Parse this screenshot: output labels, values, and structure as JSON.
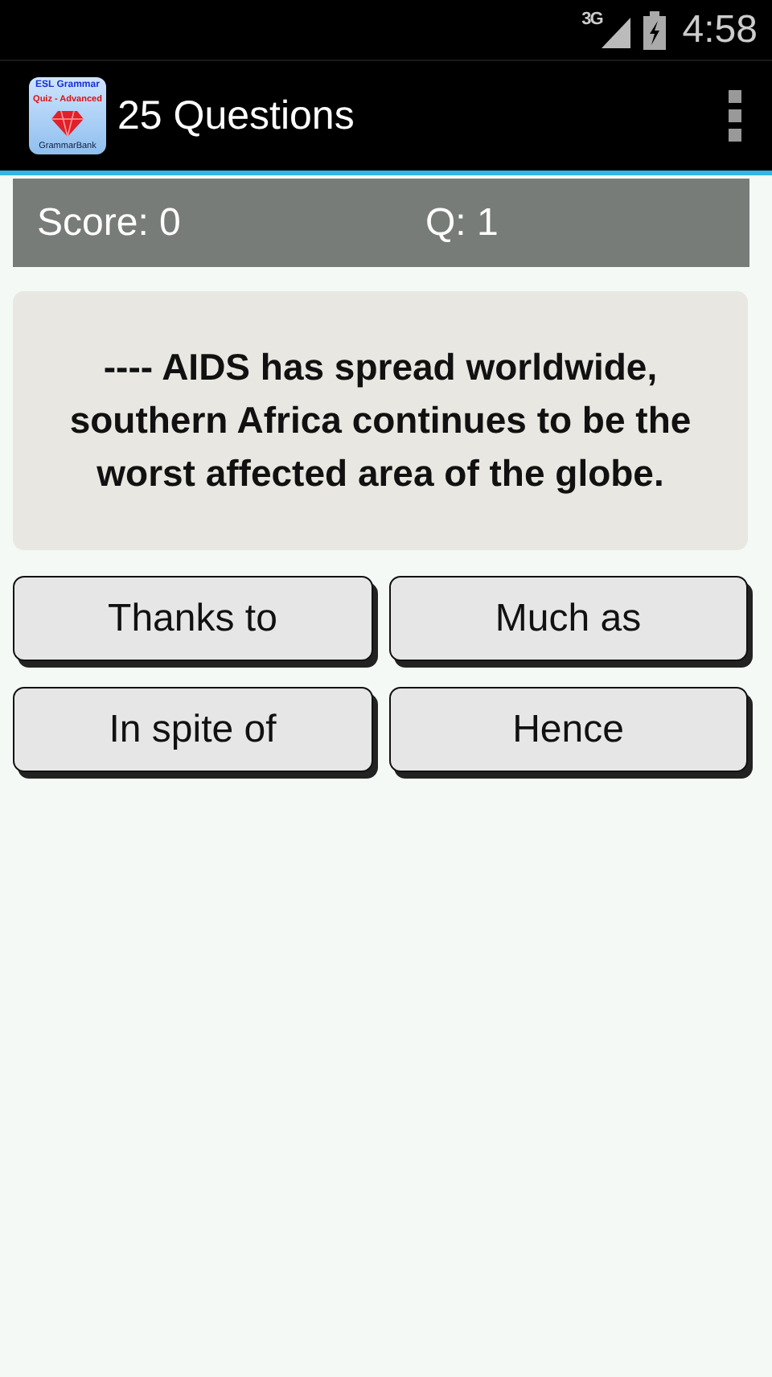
{
  "status_bar": {
    "network": "3G",
    "time": "4:58"
  },
  "action_bar": {
    "logo_lines": [
      "ESL Grammar",
      "Quiz - Advanced",
      "GrammarBank"
    ],
    "title": "25 Questions"
  },
  "score_bar": {
    "score": "Score: 0",
    "question": "Q: 1"
  },
  "question": "---- AIDS has spread worldwide, southern Africa continues to be the worst affected area of the globe.",
  "answers": [
    "Thanks to",
    "Much as",
    "In spite of",
    "Hence"
  ]
}
